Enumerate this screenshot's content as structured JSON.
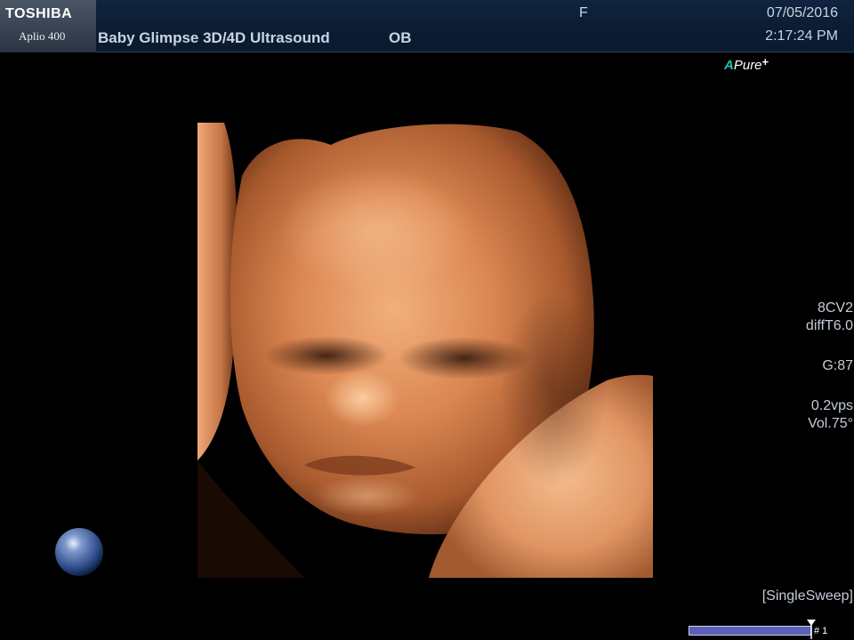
{
  "header": {
    "brand": "TOSHIBA",
    "model": "Aplio 400",
    "title": "Baby Glimpse 3D/4D Ultrasound",
    "exam": "OB",
    "gender": "F",
    "date": "07/05/2016",
    "time": "2:17:24 PM"
  },
  "logo": {
    "a": "A",
    "pure": "Pure",
    "plus": "+"
  },
  "params": {
    "probe": "8CV2",
    "map": "diffT6.0",
    "gain": "G:87",
    "rate": "0.2vps",
    "volume": "Vol.75°",
    "mode": "[SingleSweep]"
  },
  "cine": {
    "frame": "# 1",
    "progress": 1.0
  },
  "colors": {
    "header_bg": "#0b1c33",
    "header_text": "#c9d4e2",
    "brand_bg": "#3a4454",
    "logo_accent": "#23c0b3",
    "cine_bar": "#5a5fb8",
    "skin": "#d98a56"
  },
  "icons": {
    "orientation": "orientation-sphere-icon",
    "cine_marker": "cine-marker-icon"
  }
}
